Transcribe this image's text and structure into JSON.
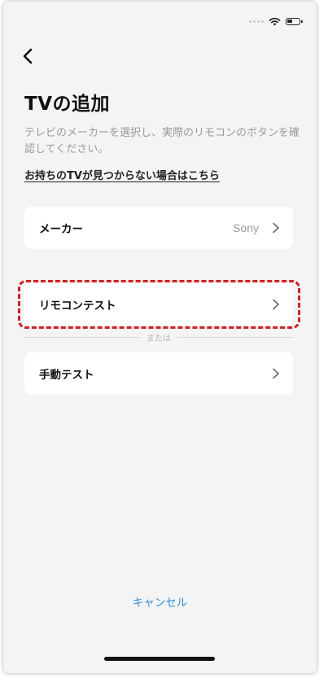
{
  "page": {
    "title": "TVの追加",
    "description": "テレビのメーカーを選択し、実際のリモコンのボタンを確認してください。",
    "help_link": "お持ちのTVが見つからない場合はこちら"
  },
  "rows": {
    "maker": {
      "label": "メーカー",
      "value": "Sony"
    },
    "remote_test": {
      "label": "リモコンテスト"
    },
    "divider_text": "または",
    "manual_test": {
      "label": "手動テスト"
    }
  },
  "footer": {
    "cancel_label": "キャンセル"
  },
  "colors": {
    "accent": "#2f8fe0",
    "highlight": "#d61f1f"
  },
  "icons": {
    "back": "chevron-left-icon",
    "row_chevron": "chevron-right-icon",
    "wifi": "wifi-icon",
    "battery": "battery-icon"
  }
}
